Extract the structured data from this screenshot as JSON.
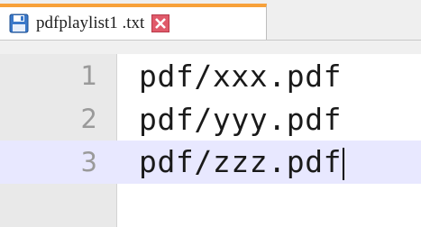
{
  "tab": {
    "filename": "pdfplaylist1 .txt",
    "file_icon": "floppy-disk-icon",
    "close_icon": "close-icon",
    "accent_color": "#f7a13a",
    "close_color": "#e05a6a"
  },
  "editor": {
    "lines": [
      {
        "number": "1",
        "text": "pdf/xxx.pdf"
      },
      {
        "number": "2",
        "text": "pdf/yyy.pdf"
      },
      {
        "number": "3",
        "text": "pdf/zzz.pdf"
      }
    ],
    "current_line": "3"
  }
}
